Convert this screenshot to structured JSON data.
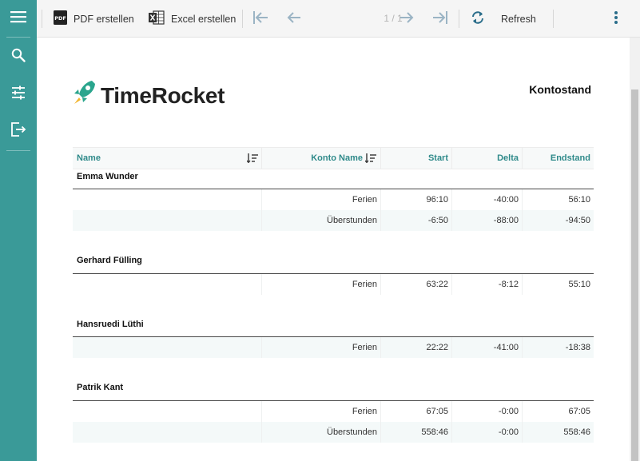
{
  "toolbar": {
    "pdf_label": "PDF erstellen",
    "excel_label": "Excel erstellen",
    "page_indicator": "1 / 1",
    "refresh_label": "Refresh"
  },
  "report": {
    "brand": "TimeRocket",
    "title": "Kontostand",
    "columns": {
      "name": "Name",
      "account": "Konto Name",
      "start": "Start",
      "delta": "Delta",
      "end": "Endstand"
    },
    "groups": [
      {
        "name": "Emma Wunder",
        "rows": [
          {
            "account": "Ferien",
            "start": "96:10",
            "delta": "-40:00",
            "end": "56:10"
          },
          {
            "account": "Überstunden",
            "start": "-6:50",
            "delta": "-88:00",
            "end": "-94:50"
          }
        ]
      },
      {
        "name": "Gerhard Fülling",
        "rows": [
          {
            "account": "Ferien",
            "start": "63:22",
            "delta": "-8:12",
            "end": "55:10"
          }
        ]
      },
      {
        "name": "Hansruedi Lüthi",
        "rows": [
          {
            "account": "Ferien",
            "start": "22:22",
            "delta": "-41:00",
            "end": "-18:38"
          }
        ]
      },
      {
        "name": "Patrik Kant",
        "rows": [
          {
            "account": "Ferien",
            "start": "67:05",
            "delta": "-0:00",
            "end": "67:05"
          },
          {
            "account": "Überstunden",
            "start": "558:46",
            "delta": "-0:00",
            "end": "558:46"
          }
        ]
      }
    ]
  },
  "colors": {
    "accent": "#3a9a98",
    "header_text": "#2f8a8a",
    "rocket": "#2aa58d"
  }
}
